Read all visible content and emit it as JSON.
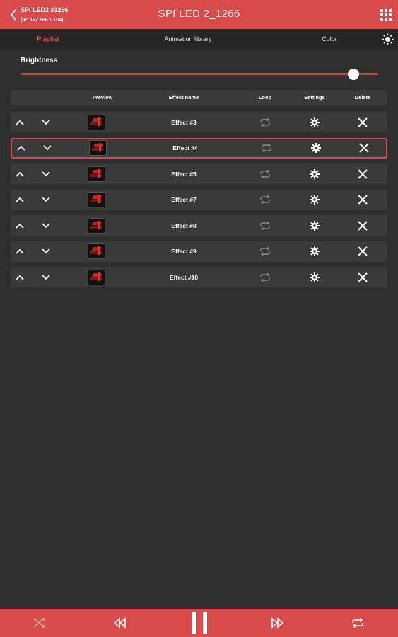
{
  "device": {
    "name": "SPI LED2 #1266",
    "ip": "(IP: 192.168.1.104)"
  },
  "title": "SPI LED 2_1266",
  "tabs": [
    {
      "label": "Playlist",
      "active": true
    },
    {
      "label": "Animation library",
      "active": false
    },
    {
      "label": "Color",
      "active": false
    }
  ],
  "brightness": {
    "label": "Brightness",
    "value_percent": 93
  },
  "table": {
    "headers": {
      "preview": "Preview",
      "effect_name": "Effect name",
      "loop": "Loop",
      "settings": "Settings",
      "delete": "Delete"
    },
    "rows": [
      {
        "name": "Effect #3",
        "selected": false
      },
      {
        "name": "Effect #4",
        "selected": true
      },
      {
        "name": "Effect #5",
        "selected": false
      },
      {
        "name": "Effect #7",
        "selected": false
      },
      {
        "name": "Effect #8",
        "selected": false
      },
      {
        "name": "Effect #9",
        "selected": false
      },
      {
        "name": "Effect #10",
        "selected": false
      }
    ]
  },
  "icons": {
    "back": "chevron-left-icon",
    "menu": "grid-icon",
    "theme": "sun-icon",
    "move_up": "chevron-up-icon",
    "move_down": "chevron-down-icon",
    "loop": "repeat-icon",
    "settings": "gear-icon",
    "delete": "close-icon",
    "shuffle": "shuffle-icon",
    "previous": "rewind-icon",
    "pause": "pause-icon",
    "next": "fast-forward-icon",
    "repeat": "repeat-icon"
  },
  "colors": {
    "accent": "#d94a4a",
    "background": "#2f2f2f",
    "row": "#3a3a3a",
    "tabbar": "#262626"
  }
}
